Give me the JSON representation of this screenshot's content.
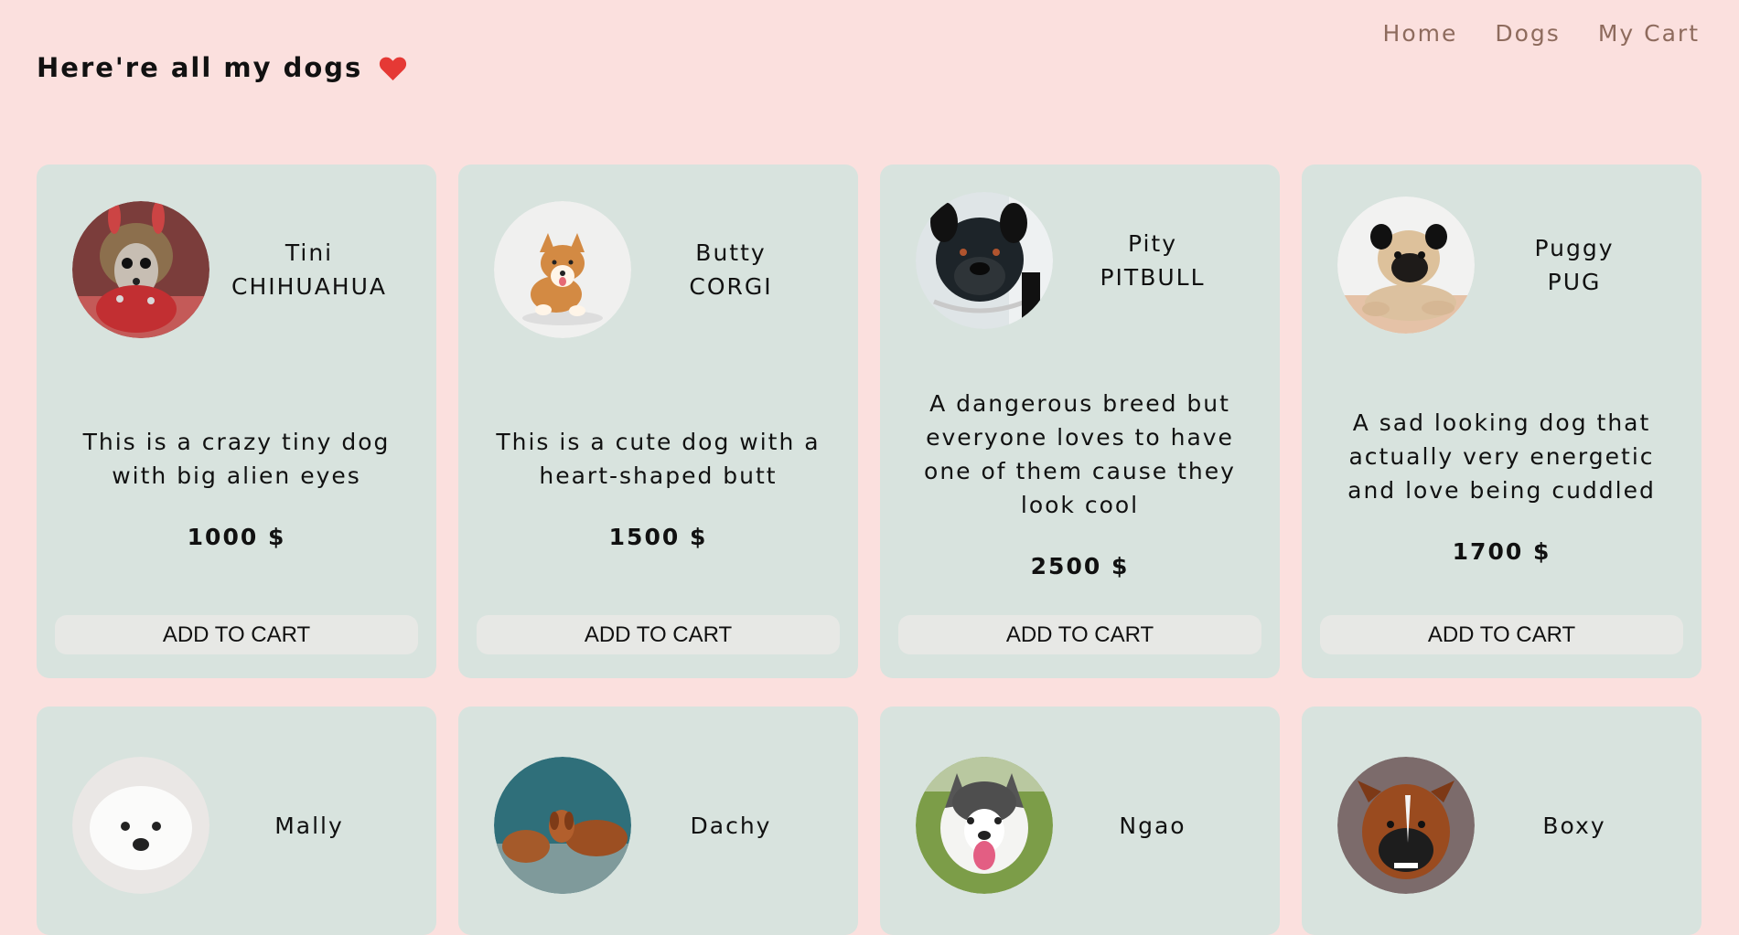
{
  "nav": {
    "home": "Home",
    "dogs": "Dogs",
    "cart": "My Cart"
  },
  "header": {
    "title": "Here're all my dogs"
  },
  "colors": {
    "page_bg": "#fbe0de",
    "card_bg": "#d8e3de",
    "nav_text": "#8e6b5d",
    "heart": "#e53935",
    "button_bg": "#e7e8e5"
  },
  "icons": {
    "heart": "heart-icon"
  },
  "dogs": [
    {
      "name": "Tini",
      "breed": "CHIHUAHUA",
      "description": "This is a crazy tiny dog with big alien eyes",
      "price": "1000 $",
      "button": "ADD TO CART"
    },
    {
      "name": "Butty",
      "breed": "CORGI",
      "description": "This is a cute dog with a heart-shaped butt",
      "price": "1500 $",
      "button": "ADD TO CART"
    },
    {
      "name": "Pity",
      "breed": "PITBULL",
      "description": "A dangerous breed but everyone loves to have one of them cause they look cool",
      "price": "2500 $",
      "button": "ADD TO CART"
    },
    {
      "name": "Puggy",
      "breed": "PUG",
      "description": "A sad looking dog that actually very energetic and love being cuddled",
      "price": "1700 $",
      "button": "ADD TO CART"
    },
    {
      "name": "Mally"
    },
    {
      "name": "Dachy"
    },
    {
      "name": "Ngao"
    },
    {
      "name": "Boxy"
    }
  ]
}
